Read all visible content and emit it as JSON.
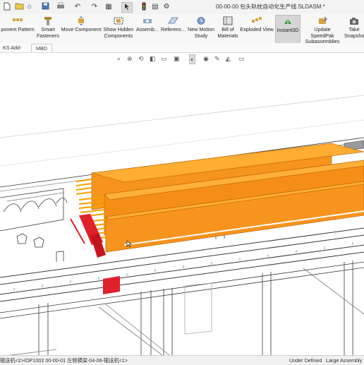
{
  "window": {
    "title": "00-00-00 包头轨枕自动化生产线.SLDASM *"
  },
  "quick_access": {
    "icons": [
      "new-document-icon",
      "open-folder-icon",
      "save-icon",
      "print-icon",
      "undo-icon",
      "redo-icon",
      "select-arrow-icon",
      "rebuild-icon",
      "file-properties-icon",
      "options-gear-icon"
    ]
  },
  "ribbon": {
    "buttons": [
      {
        "label_line1": "ponent Pattern",
        "label_line2": ""
      },
      {
        "label_line1": "Smart",
        "label_line2": "Fasteners"
      },
      {
        "label_line1": "Move Component",
        "label_line2": ""
      },
      {
        "label_line1": "Show Hidden",
        "label_line2": "Components"
      },
      {
        "label_line1": "Assemb...",
        "label_line2": ""
      },
      {
        "label_line1": "Referenc...",
        "label_line2": ""
      },
      {
        "label_line1": "New Motion",
        "label_line2": "Study"
      },
      {
        "label_line1": "Bill of",
        "label_line2": "Materials"
      },
      {
        "label_line1": "Exploded View",
        "label_line2": ""
      },
      {
        "label_line1": "Instant3D",
        "label_line2": ""
      },
      {
        "label_line1": "Update SpeedPak",
        "label_line2": "Subassemblies"
      },
      {
        "label_line1": "Take",
        "label_line2": "Snapsho"
      }
    ]
  },
  "tabs": {
    "items": [
      {
        "label": "KS Add-Ins"
      },
      {
        "label": "MBD"
      }
    ],
    "selected_index": 1
  },
  "heads_up_toolbar": {
    "icons": [
      "zoom-to-fit-icon",
      "zoom-to-area-icon",
      "previous-view-icon",
      "section-view-icon",
      "dynamic-annotation-icon",
      "view-orientation-icon",
      "display-style-icon",
      "hide-show-items-icon",
      "edit-appearance-icon",
      "apply-scene-icon",
      "view-settings-icon",
      "display-pane-icon"
    ]
  },
  "status_bar": {
    "path": "输送机<2>/OP1002 00-00-01 左侧横梁-04-06-输送机<1>",
    "state": "Under Defined",
    "mode": "Large Assembly"
  },
  "colors": {
    "beam_orange": "#f7941d",
    "beam_orange_top": "#ffad33",
    "beam_orange_dark": "#d97400",
    "red_part": "#e0202a",
    "frame_line": "#3a3a3a"
  }
}
